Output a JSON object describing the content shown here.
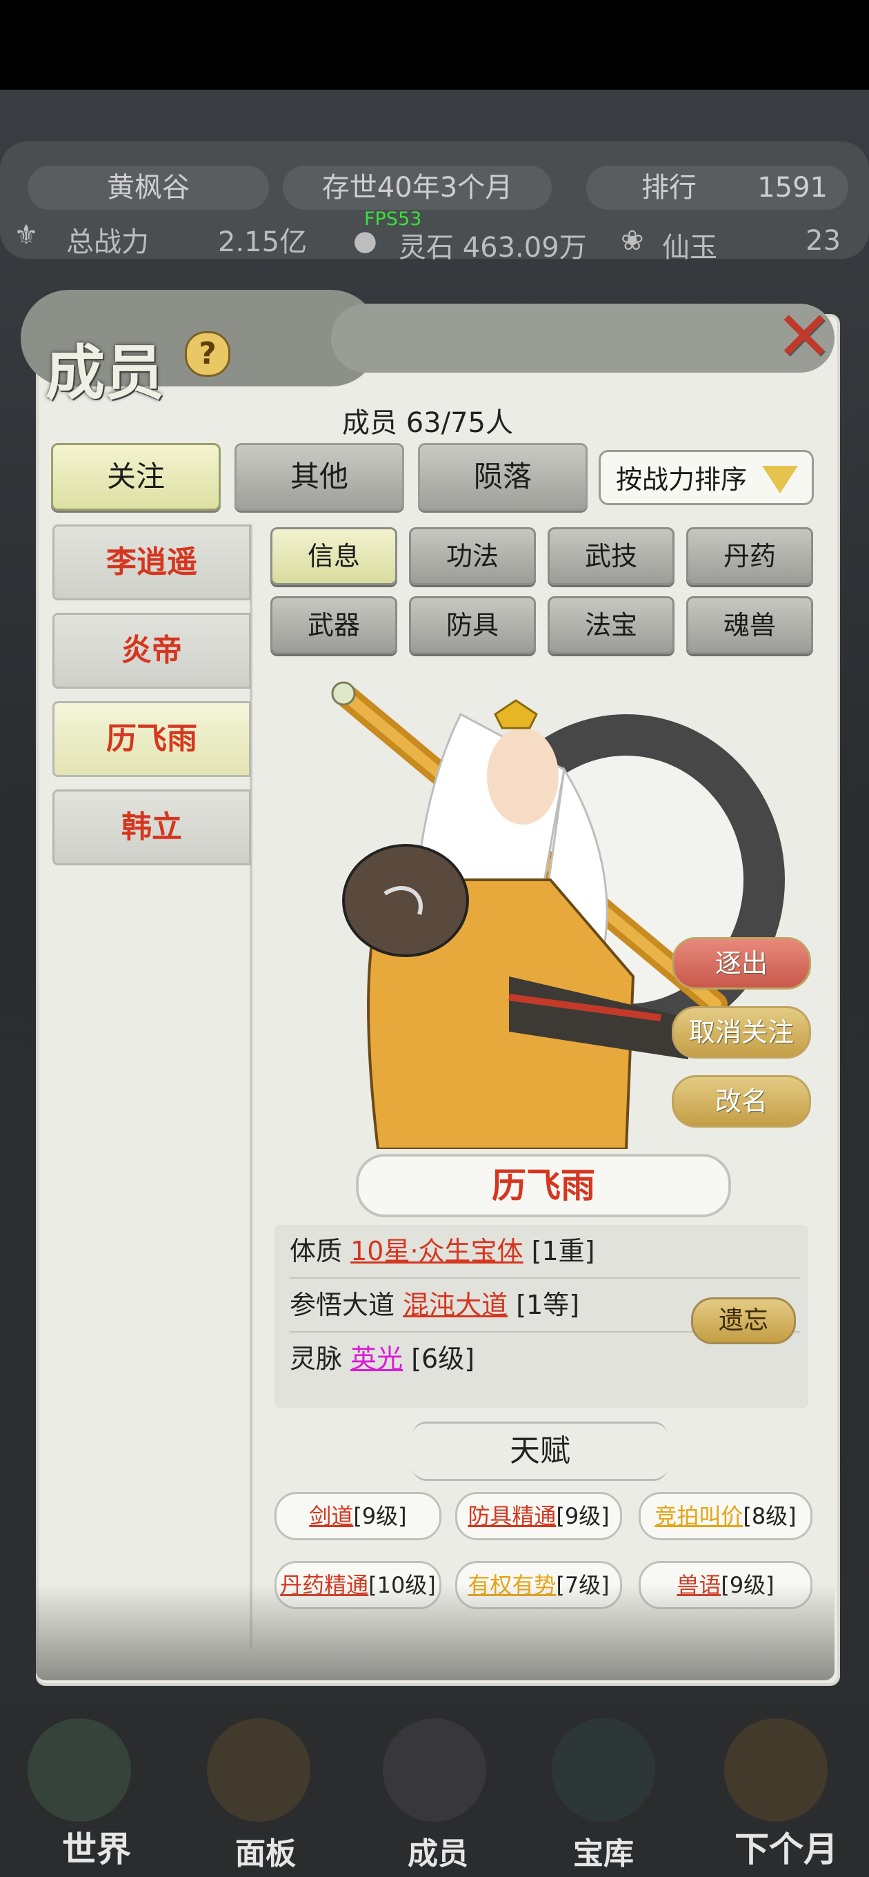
{
  "status_bar": {},
  "background": {
    "sect_name": "黄枫谷",
    "existence": "存世40年3个月",
    "ranking_label": "排行",
    "ranking_value": "1591",
    "total_power_label": "总战力",
    "total_power_value": "2.15亿",
    "spirit_stone": "灵石 463.09万",
    "immortal_jade_label": "仙玉",
    "immortal_jade_value": "23",
    "fps": "FPS53"
  },
  "modal": {
    "title": "成员",
    "help": "?",
    "member_count": "成员  63/75人",
    "tabs": [
      "关注",
      "其他",
      "陨落"
    ],
    "sort_label": "按战力排序",
    "members": [
      "李逍遥",
      "炎帝",
      "历飞雨",
      "韩立"
    ],
    "sub_tabs": [
      "信息",
      "功法",
      "武技",
      "丹药",
      "武器",
      "防具",
      "法宝",
      "魂兽"
    ],
    "actions": {
      "expel": "逐出",
      "unfollow": "取消关注",
      "rename": "改名"
    },
    "character_name": "历飞雨",
    "attributes": {
      "constitution_label": "体质",
      "constitution_value": "10星·众生宝体",
      "constitution_level": "[1重]",
      "dao_label": "参悟大道",
      "dao_value": "混沌大道",
      "dao_level": "[1等]",
      "forget_button": "遗忘",
      "vein_label": "灵脉",
      "vein_value": "英光",
      "vein_level": "[6级]"
    },
    "talent_title": "天赋",
    "talents": [
      {
        "name": "剑道",
        "level": "[9级]",
        "color": "red"
      },
      {
        "name": "防具精通",
        "level": "[9级]",
        "color": "red"
      },
      {
        "name": "竞拍叫价",
        "level": "[8级]",
        "color": "orange"
      },
      {
        "name": "丹药精通",
        "level": "[10级]",
        "color": "red"
      },
      {
        "name": "有权有势",
        "level": "[7级]",
        "color": "orange"
      },
      {
        "name": "兽语",
        "level": "[9级]",
        "color": "red"
      }
    ]
  },
  "bottom_nav": [
    "世界",
    "面板",
    "成员",
    "宝库",
    "下个月"
  ],
  "colors": {
    "red": "#d5361f",
    "pink": "#d91bd6",
    "orange": "#e6a417",
    "fps": "#39e23a"
  }
}
